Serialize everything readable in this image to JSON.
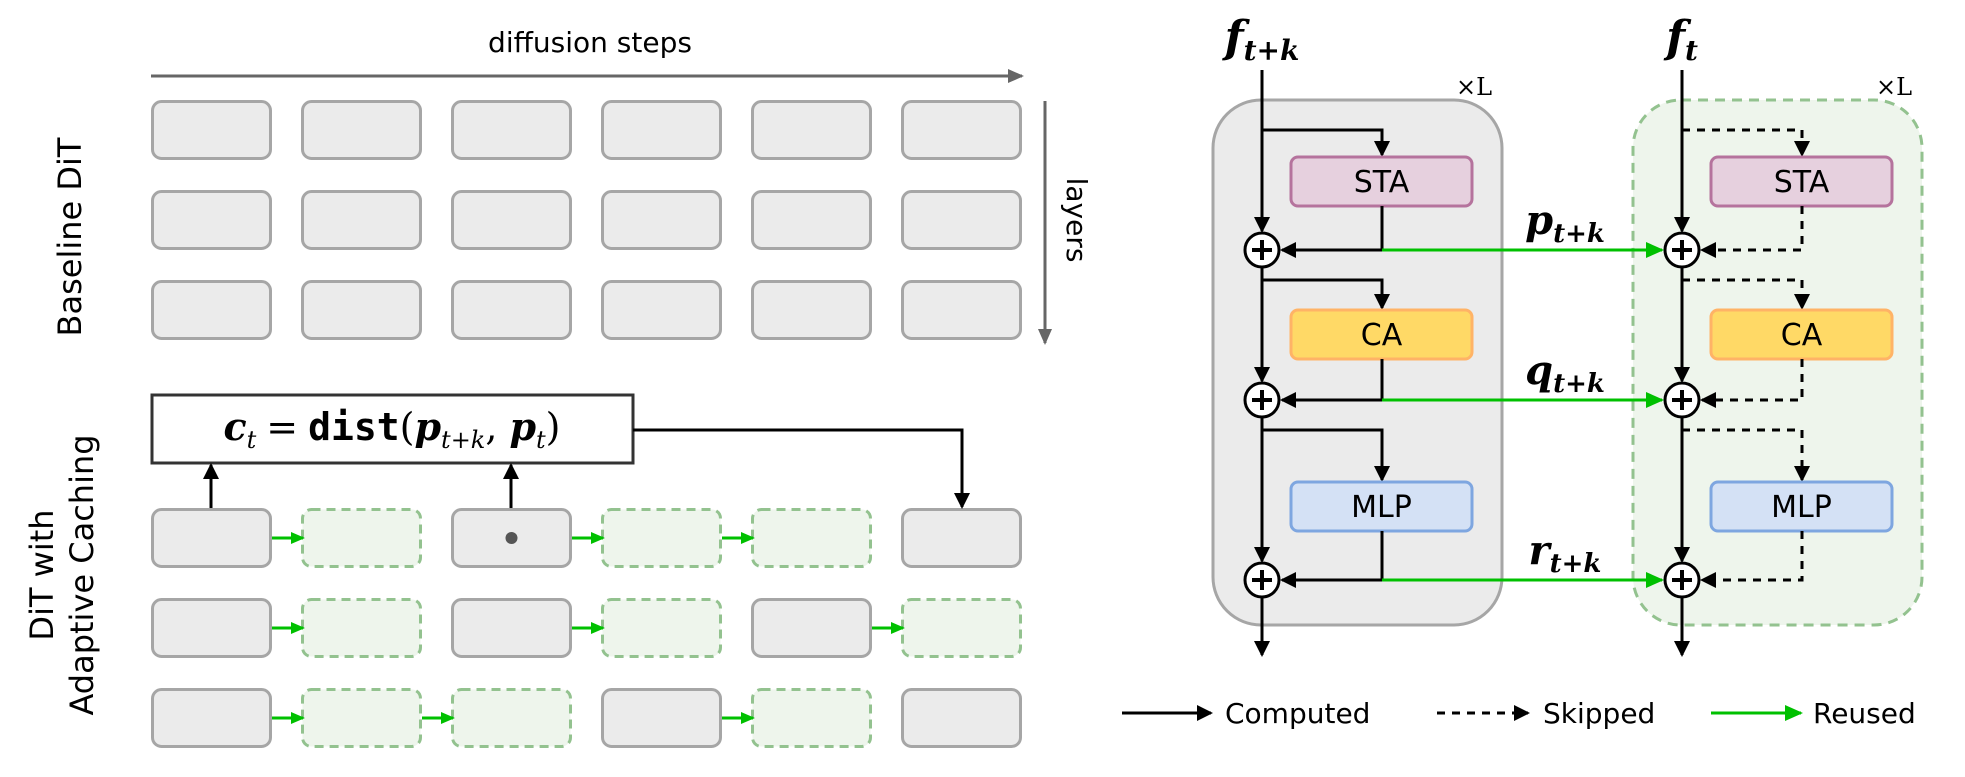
{
  "left_panel": {
    "axis_x_label": "diffusion steps",
    "axis_y_label": "layers",
    "baseline_label": "Baseline DiT",
    "caching_label_line1": "DiT with",
    "caching_label_line2": "Adaptive Caching",
    "formula": {
      "lhs": "c",
      "lhs_sub": "t",
      "equals": "=",
      "func": "dist",
      "open": "(",
      "arg1": "p",
      "arg1_sub": "t+k",
      "comma": ",",
      "arg2": "p",
      "arg2_sub": "t",
      "close": ")"
    },
    "baseline_grid": [
      [
        "computed",
        "computed",
        "computed",
        "computed",
        "computed",
        "computed"
      ],
      [
        "computed",
        "computed",
        "computed",
        "computed",
        "computed",
        "computed"
      ],
      [
        "computed",
        "computed",
        "computed",
        "computed",
        "computed",
        "computed"
      ]
    ],
    "caching_grid": [
      [
        "computed",
        "reused",
        "computed",
        "reused",
        "reused",
        "computed"
      ],
      [
        "computed",
        "reused",
        "computed",
        "reused",
        "computed",
        "reused"
      ],
      [
        "computed",
        "reused",
        "reused",
        "computed",
        "reused",
        "computed"
      ]
    ],
    "formula_inputs_from_columns": [
      0,
      2
    ],
    "formula_output_to_column": 5,
    "dot_marker_cell": [
      0,
      2
    ]
  },
  "right_panel": {
    "left_block": {
      "input_label": "f",
      "input_sub": "t+k",
      "repeat_label": "×L",
      "modules": [
        "STA",
        "CA",
        "MLP"
      ]
    },
    "right_block": {
      "input_label": "f",
      "input_sub": "t",
      "repeat_label": "×L",
      "modules": [
        "STA",
        "CA",
        "MLP"
      ]
    },
    "reuse_links": [
      {
        "label": "p",
        "sub": "t+k"
      },
      {
        "label": "q",
        "sub": "t+k"
      },
      {
        "label": "r",
        "sub": "t+k"
      }
    ],
    "plus_symbol": "+"
  },
  "legend": {
    "computed": "Computed",
    "skipped": "Skipped",
    "reused": "Reused"
  },
  "colors": {
    "computed_fill": "#ebebeb",
    "computed_stroke": "#a6a6a6",
    "reused_fill": "#eef5ec",
    "reused_stroke": "#93c28f",
    "reuse_arrow": "#00c000",
    "sta_fill": "#e6d0de",
    "sta_stroke": "#b5739d",
    "ca_fill": "#ffd966",
    "ca_stroke": "#ffb366",
    "mlp_fill": "#d4e1f5",
    "mlp_stroke": "#7ea6e0",
    "axis": "#666666",
    "ink": "#000000"
  }
}
